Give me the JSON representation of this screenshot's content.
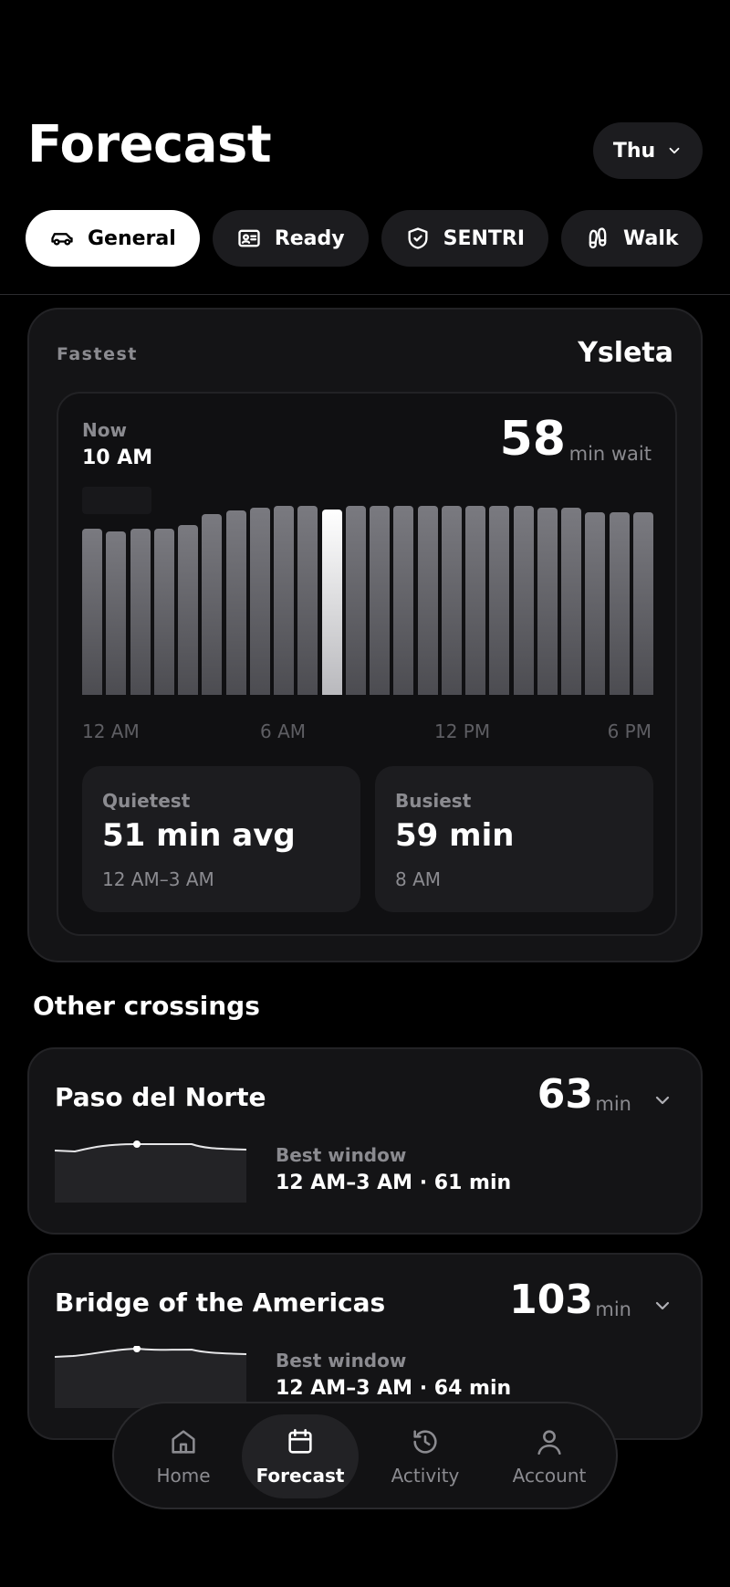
{
  "header": {
    "title": "Forecast",
    "day": "Thu"
  },
  "filters": [
    {
      "label": "General",
      "icon": "car-icon",
      "active": true
    },
    {
      "label": "Ready",
      "icon": "id-card-icon",
      "active": false
    },
    {
      "label": "SENTRI",
      "icon": "shield-check-icon",
      "active": false
    },
    {
      "label": "Walk",
      "icon": "footprints-icon",
      "active": false
    }
  ],
  "main": {
    "fastest_label": "Fastest",
    "port": "Ysleta",
    "now_label": "Now",
    "now_time": "10 AM",
    "wait_value": "58",
    "wait_unit": "min wait",
    "x_ticks": [
      "12 AM",
      "6 AM",
      "12 PM",
      "6 PM"
    ],
    "quietest": {
      "label": "Quietest",
      "value": "51 min avg",
      "sub": "12 AM–3 AM"
    },
    "busiest": {
      "label": "Busiest",
      "value": "59 min",
      "sub": "8 AM"
    }
  },
  "chart_data": {
    "type": "bar",
    "categories": [
      "12 AM",
      "1 AM",
      "2 AM",
      "3 AM",
      "4 AM",
      "5 AM",
      "6 AM",
      "7 AM",
      "8 AM",
      "9 AM",
      "10 AM",
      "11 AM",
      "12 PM",
      "1 PM",
      "2 PM",
      "3 PM",
      "4 PM",
      "5 PM",
      "6 PM",
      "7 PM",
      "8 PM",
      "9 PM",
      "10 PM",
      "11 PM"
    ],
    "values": [
      52.0,
      51.0,
      52.0,
      52.0,
      53.0,
      56.5,
      57.5,
      58.5,
      59.0,
      59.0,
      58.0,
      59.0,
      59.0,
      59.0,
      59.0,
      59.0,
      59.0,
      59.0,
      59.0,
      58.5,
      58.5,
      57.0,
      57.0,
      57.0
    ],
    "highlight_category": "10 AM",
    "ylim": [
      0,
      65
    ]
  },
  "other_title": "Other crossings",
  "crossings": [
    {
      "name": "Paso del Norte",
      "value": "63",
      "unit": "min",
      "best_label": "Best window",
      "best_value": "12 AM–3 AM · 61 min"
    },
    {
      "name": "Bridge of the Americas",
      "value": "103",
      "unit": "min",
      "best_label": "Best window",
      "best_value": "12 AM–3 AM · 64 min"
    }
  ],
  "nav": [
    {
      "label": "Home",
      "icon": "home-icon",
      "active": false
    },
    {
      "label": "Forecast",
      "icon": "calendar-icon",
      "active": true
    },
    {
      "label": "Activity",
      "icon": "history-icon",
      "active": false
    },
    {
      "label": "Account",
      "icon": "user-icon",
      "active": false
    }
  ]
}
